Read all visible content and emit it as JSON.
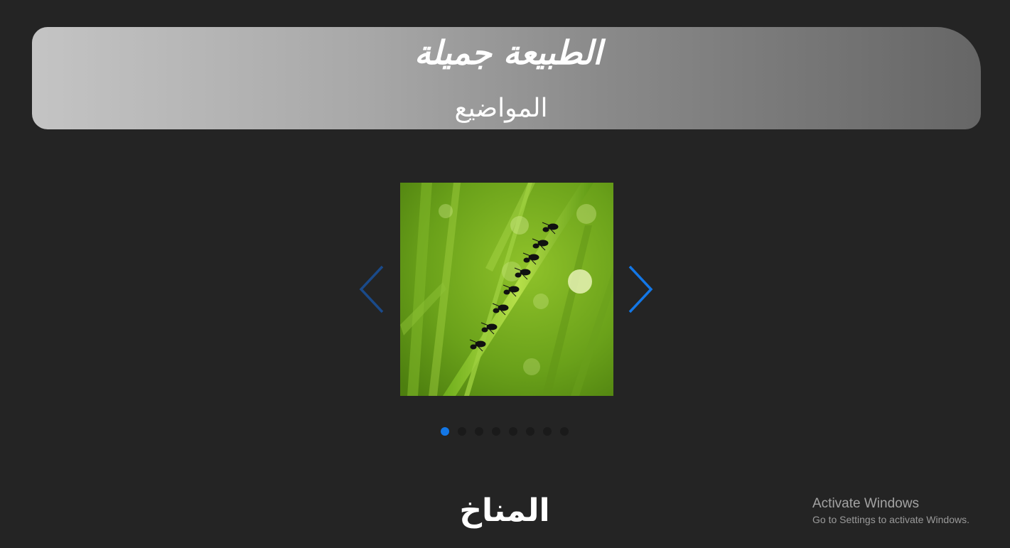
{
  "header": {
    "title": "الطبيعة جميلة",
    "nav_topics": "المواضيع"
  },
  "carousel": {
    "current_slide": 1,
    "total_slides": 8,
    "image_description_icon": "ants-on-grass-image",
    "prev_icon": "chevron-left-icon",
    "next_icon": "chevron-right-icon",
    "accent_color": "#1377e6",
    "inactive_dot_color": "#1a1a1a"
  },
  "section": {
    "title": "المناخ"
  },
  "watermark": {
    "title": "Activate Windows",
    "subtitle": "Go to Settings to activate Windows."
  },
  "colors": {
    "background": "#242424",
    "header_gradient_start": "#c4c4c4",
    "header_gradient_end": "#666666",
    "text": "#ffffff"
  }
}
